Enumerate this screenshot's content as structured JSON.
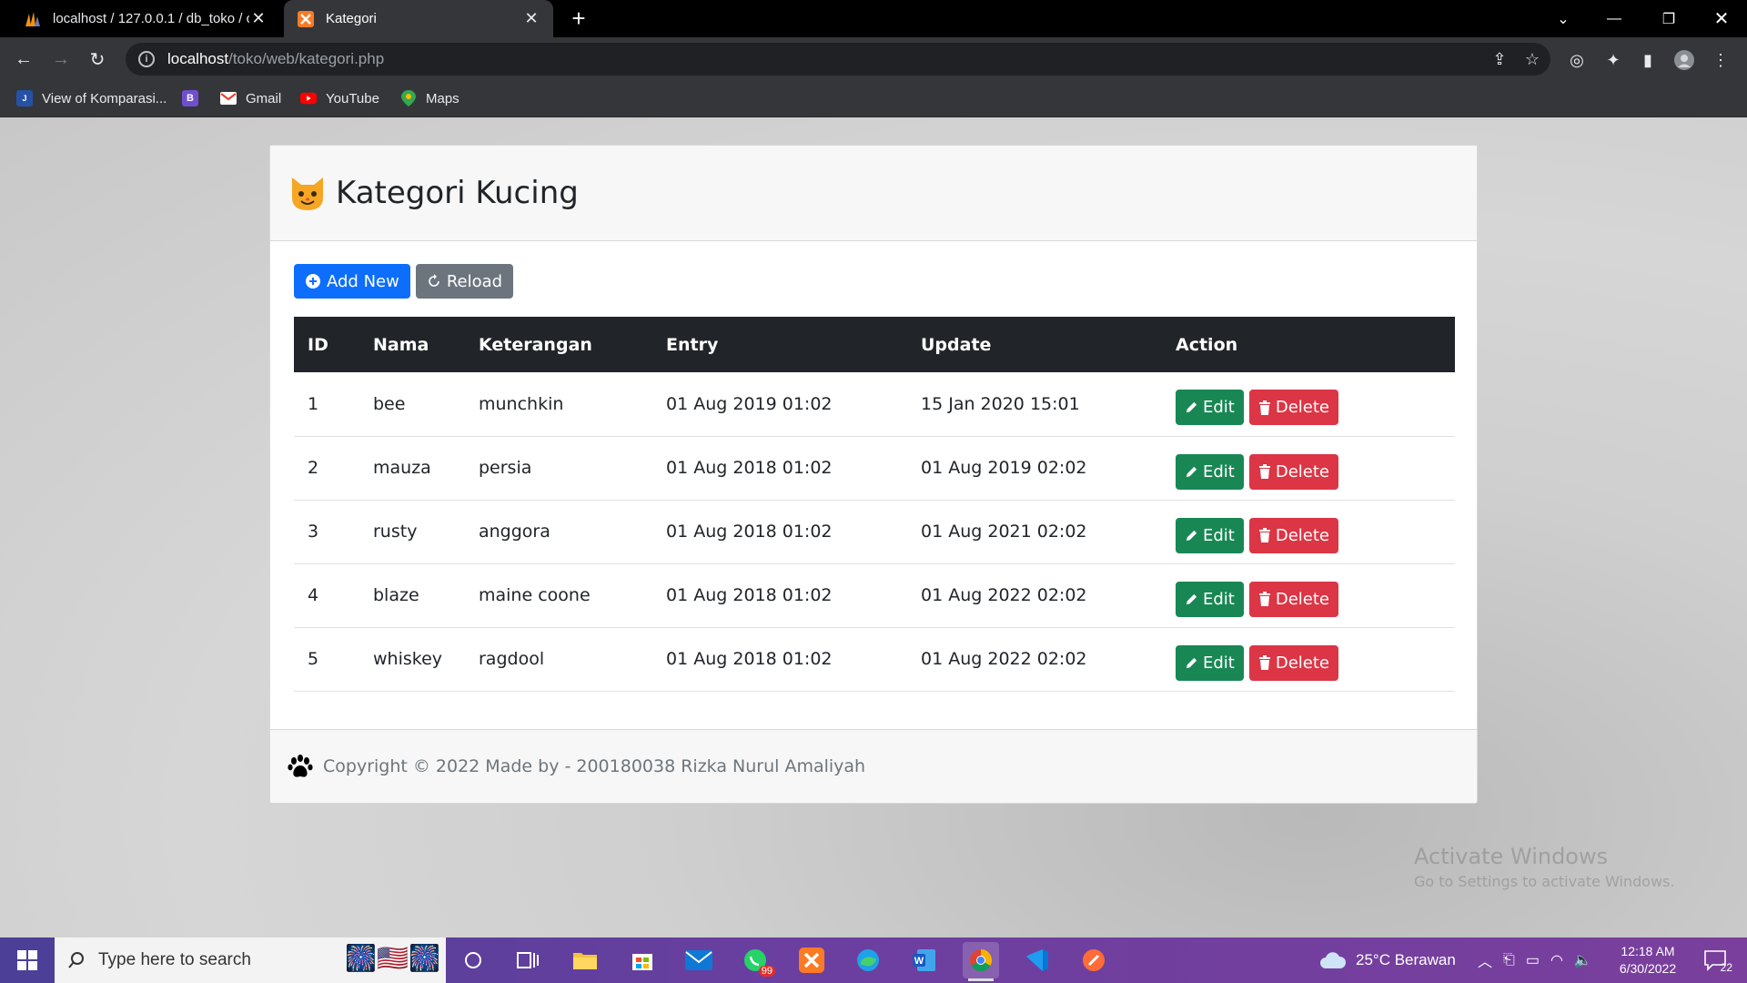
{
  "browser": {
    "tabs": [
      {
        "title": "localhost / 127.0.0.1 / db_toko / c",
        "active": false
      },
      {
        "title": "Kategori",
        "active": true
      }
    ],
    "url_host": "localhost",
    "url_path": "/toko/web/kategori.php",
    "bookmarks": [
      {
        "label": "View of Komparasi..."
      },
      {
        "label": ""
      },
      {
        "label": "Gmail"
      },
      {
        "label": "YouTube"
      },
      {
        "label": "Maps"
      }
    ]
  },
  "page": {
    "title": "Kategori Kucing",
    "add_label": "Add New",
    "reload_label": "Reload",
    "table": {
      "headers": [
        "ID",
        "Nama",
        "Keterangan",
        "Entry",
        "Update",
        "Action"
      ],
      "rows": [
        {
          "id": "1",
          "nama": "bee",
          "keterangan": "munchkin",
          "entry": "01 Aug 2019 01:02",
          "update": "15 Jan 2020 15:01"
        },
        {
          "id": "2",
          "nama": "mauza",
          "keterangan": "persia",
          "entry": "01 Aug 2018 01:02",
          "update": "01 Aug 2019 02:02"
        },
        {
          "id": "3",
          "nama": "rusty",
          "keterangan": "anggora",
          "entry": "01 Aug 2018 01:02",
          "update": "01 Aug 2021 02:02"
        },
        {
          "id": "4",
          "nama": "blaze",
          "keterangan": "maine coone",
          "entry": "01 Aug 2018 01:02",
          "update": "01 Aug 2022 02:02"
        },
        {
          "id": "5",
          "nama": "whiskey",
          "keterangan": "ragdool",
          "entry": "01 Aug 2018 01:02",
          "update": "01 Aug 2022 02:02"
        }
      ],
      "edit_label": "Edit",
      "delete_label": "Delete"
    },
    "footer": "Copyright © 2022 Made by - 200180038 Rizka Nurul Amaliyah",
    "watermark_title": "Activate Windows",
    "watermark_sub": "Go to Settings to activate Windows."
  },
  "taskbar": {
    "search_placeholder": "Type here to search",
    "whatsapp_badge": "99",
    "weather": "25°C  Berawan",
    "time": "12:18 AM",
    "date": "6/30/2022",
    "notifications": "22"
  },
  "colors": {
    "primary": "#0d6efd",
    "secondary": "#6c757d",
    "success": "#198754",
    "danger": "#dc3545",
    "table_head": "#212529"
  }
}
